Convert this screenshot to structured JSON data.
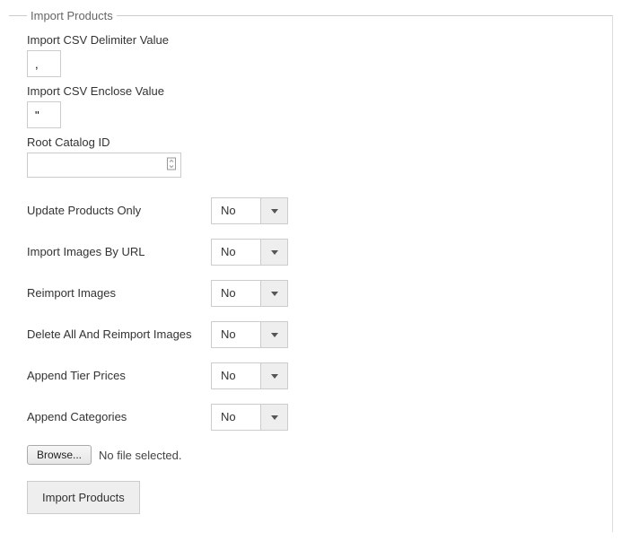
{
  "fieldset": {
    "legend": "Import Products"
  },
  "textFields": {
    "delimiter": {
      "label": "Import CSV Delimiter Value",
      "value": ","
    },
    "enclose": {
      "label": "Import CSV Enclose Value",
      "value": "\""
    },
    "rootCatalog": {
      "label": "Root Catalog ID",
      "value": ""
    }
  },
  "selects": {
    "updateOnly": {
      "label": "Update Products Only",
      "value": "No"
    },
    "importByUrl": {
      "label": "Import Images By URL",
      "value": "No"
    },
    "reimport": {
      "label": "Reimport Images",
      "value": "No"
    },
    "deleteReimport": {
      "label": "Delete All And Reimport Images",
      "value": "No"
    },
    "appendTier": {
      "label": "Append Tier Prices",
      "value": "No"
    },
    "appendCat": {
      "label": "Append Categories",
      "value": "No"
    }
  },
  "file": {
    "browse_label": "Browse...",
    "status": "No file selected."
  },
  "submit": {
    "label": "Import Products"
  }
}
